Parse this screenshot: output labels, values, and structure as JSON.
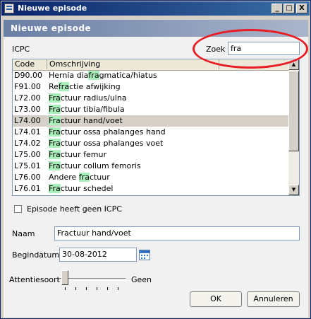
{
  "window": {
    "title": "Nieuwe episode",
    "buttons": [
      "_",
      "□",
      "X"
    ]
  },
  "header": {
    "title": "Nieuwe episode"
  },
  "icpc": {
    "label": "ICPC",
    "search_label": "Zoek",
    "search_value": "fra",
    "columns": [
      "Code",
      "Omschrijving"
    ],
    "rows": [
      {
        "code": "D90.00",
        "pre": "Hernia dia",
        "match": "fra",
        "post": "gmatica/hiatus"
      },
      {
        "code": "F91.00",
        "pre": "Re",
        "match": "fra",
        "post": "ctie afwijking"
      },
      {
        "code": "L72.00",
        "pre": "",
        "match": "Fra",
        "post": "ctuur radius/ulna"
      },
      {
        "code": "L73.00",
        "pre": "",
        "match": "Fra",
        "post": "ctuur tibia/fibula"
      },
      {
        "code": "L74.00",
        "pre": "",
        "match": "Fra",
        "post": "ctuur hand/voet",
        "selected": true
      },
      {
        "code": "L74.01",
        "pre": "",
        "match": "Fra",
        "post": "ctuur ossa phalanges hand"
      },
      {
        "code": "L74.02",
        "pre": "",
        "match": "Fra",
        "post": "ctuur ossa phalanges voet"
      },
      {
        "code": "L75.00",
        "pre": "",
        "match": "Fra",
        "post": "ctuur femur"
      },
      {
        "code": "L75.01",
        "pre": "",
        "match": "Fra",
        "post": "ctuur collum femoris"
      },
      {
        "code": "L76.00",
        "pre": "Andere ",
        "match": "fra",
        "post": "ctuur"
      },
      {
        "code": "L76.01",
        "pre": "",
        "match": "Fra",
        "post": "ctuur schedel"
      }
    ]
  },
  "no_icpc_checkbox": {
    "label": "Episode heeft geen ICPC",
    "checked": false
  },
  "naam": {
    "label": "Naam",
    "value": "Fractuur hand/voet"
  },
  "begindatum": {
    "label": "Begindatum",
    "value": "30-08-2012"
  },
  "attentiesoort": {
    "label": "Attentiesoort",
    "value_label": "Geen",
    "level": 0
  },
  "buttons": {
    "ok": "OK",
    "cancel": "Annuleren"
  },
  "colors": {
    "highlight": "#aaeebb",
    "annotation": "#e81c24",
    "title_bar": "#0a246a"
  }
}
